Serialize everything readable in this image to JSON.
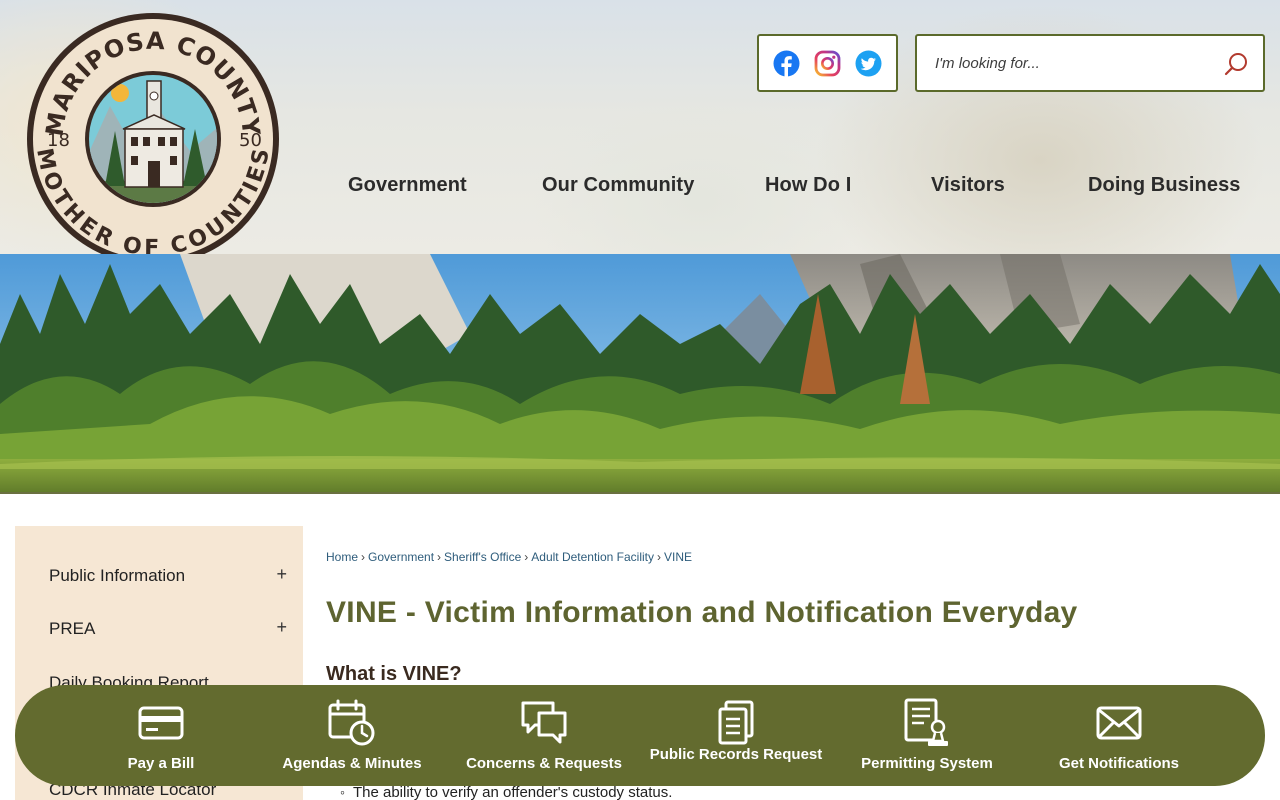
{
  "logo": {
    "top_text": "MARIPOSA COUNTY",
    "bottom_text": "MOTHER OF COUNTIES",
    "year_left": "18",
    "year_right": "50"
  },
  "social": {
    "facebook": "facebook-icon",
    "instagram": "instagram-icon",
    "twitter": "twitter-icon"
  },
  "search": {
    "placeholder": "I'm looking for...",
    "value": ""
  },
  "nav": [
    {
      "label": "Government"
    },
    {
      "label": "Our Community"
    },
    {
      "label": "How Do I"
    },
    {
      "label": "Visitors"
    },
    {
      "label": "Doing Business"
    }
  ],
  "sidebar": {
    "items": [
      {
        "label": "Public Information",
        "expand": "+"
      },
      {
        "label": "PREA",
        "expand": "+"
      },
      {
        "label": "Daily Booking Report"
      },
      {
        "label": "CDCR Inmate Locator"
      }
    ]
  },
  "breadcrumb": [
    {
      "label": "Home"
    },
    {
      "label": "Government"
    },
    {
      "label": "Sheriff's Office"
    },
    {
      "label": "Adult Detention Facility"
    },
    {
      "label": "VINE"
    }
  ],
  "page": {
    "title": "VINE - Victim Information and Notification Everyday",
    "section_heading": "What is VINE?",
    "bullet": "The ability to verify an offender's custody status."
  },
  "quicklinks": [
    {
      "label": "Pay a Bill",
      "icon": "credit-card-icon"
    },
    {
      "label": "Agendas & Minutes",
      "icon": "calendar-clock-icon"
    },
    {
      "label": "Concerns & Requests",
      "icon": "chat-bubbles-icon"
    },
    {
      "label": "Public Records Request",
      "icon": "documents-icon"
    },
    {
      "label": "Permitting System",
      "icon": "permit-stamp-icon"
    },
    {
      "label": "Get Notifications",
      "icon": "envelope-icon"
    }
  ],
  "colors": {
    "brand_olive": "#636b2f",
    "title_olive": "#5e6430",
    "sidebar_bg": "#f6e7d4",
    "link_blue": "#2f5d7c"
  }
}
